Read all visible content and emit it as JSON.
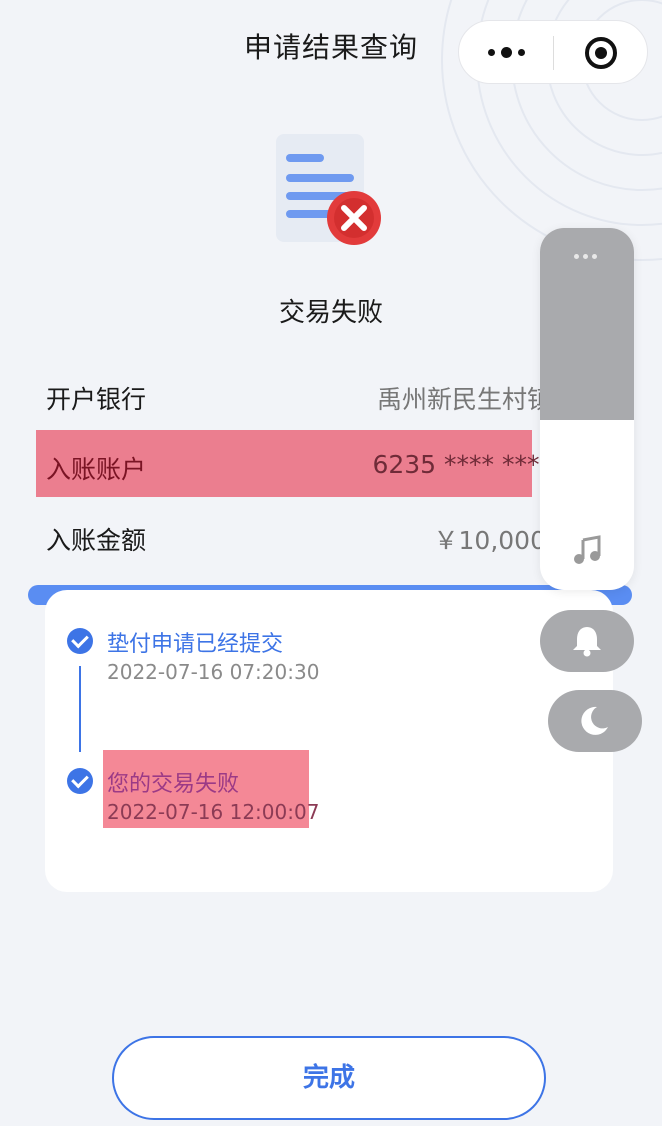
{
  "header": {
    "title": "申请结果查询",
    "more_icon": "more-dots-icon",
    "close_icon": "target-close-icon"
  },
  "status": {
    "icon": "document-fail-icon",
    "text": "交易失败"
  },
  "info": {
    "bank_label": "开户银行",
    "bank_value": "禹州新民生村镇",
    "account_label": "入账账户",
    "account_value": "6235 **** ****",
    "amount_label": "入账金额",
    "amount_value": "￥10,000"
  },
  "timeline": [
    {
      "title": "垫付申请已经提交",
      "time": "2022-07-16 07:20:30"
    },
    {
      "title": "您的交易失败",
      "time": "2022-07-16 12:00:07"
    }
  ],
  "float_controls": {
    "music_icon": "music-note-icon",
    "bell_icon": "bell-icon",
    "moon_icon": "moon-icon"
  },
  "done_label": "完成",
  "colors": {
    "accent": "#3d74e6",
    "fail_red": "#e23b3b",
    "highlight": "#e84c62"
  }
}
